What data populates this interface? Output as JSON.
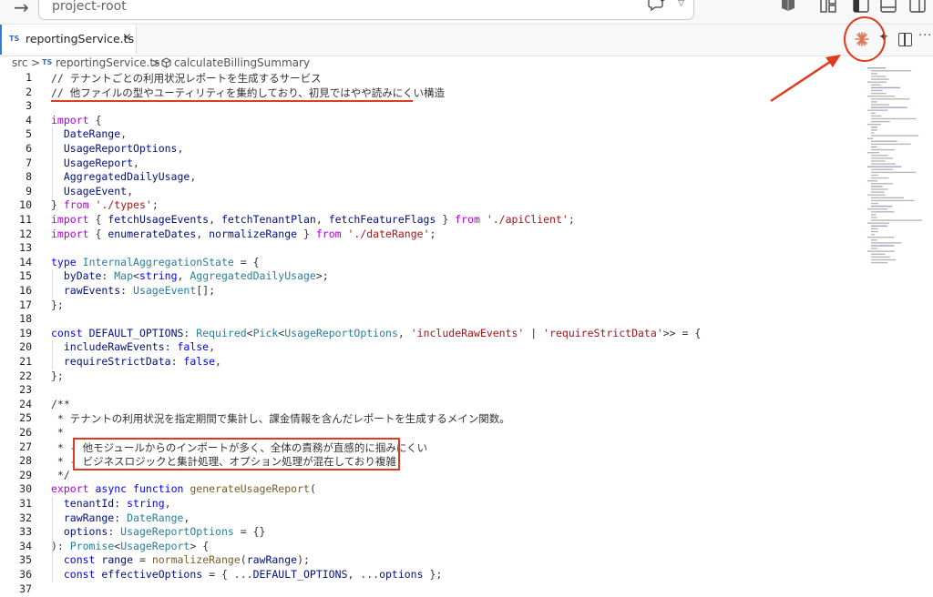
{
  "title_bar": {
    "back_label": "→",
    "command_center_text": "project-root"
  },
  "tab": {
    "badge": "TS",
    "label": "reportingService.ts",
    "close": "×"
  },
  "editor_actions": {
    "more": "···"
  },
  "breadcrumb": {
    "folder": "src",
    "sep": ">",
    "file_badge": "TS",
    "file": "reportingService.ts",
    "symbol": "calculateBillingSummary"
  },
  "code_lines": [
    {
      "n": "1",
      "segs": [
        [
          "cm",
          "// "
        ],
        [
          "cmj",
          "テナントごとの利用状況レポートを生成するサービス"
        ]
      ]
    },
    {
      "n": "2",
      "segs": [
        [
          "cm",
          "// "
        ],
        [
          "cmj",
          "他ファイルの型やユーティリティを集約しており、初見ではやや読みにくい構造"
        ]
      ]
    },
    {
      "n": "3",
      "segs": []
    },
    {
      "n": "4",
      "segs": [
        [
          "kw",
          "import"
        ],
        [
          "pl",
          " {"
        ]
      ]
    },
    {
      "n": "5",
      "segs": [
        [
          "va",
          "  DateRange"
        ],
        [
          "pl",
          ","
        ]
      ]
    },
    {
      "n": "6",
      "segs": [
        [
          "va",
          "  UsageReportOptions"
        ],
        [
          "pl",
          ","
        ]
      ]
    },
    {
      "n": "7",
      "segs": [
        [
          "va",
          "  UsageReport"
        ],
        [
          "pl",
          ","
        ]
      ]
    },
    {
      "n": "8",
      "segs": [
        [
          "va",
          "  AggregatedDailyUsage"
        ],
        [
          "pl",
          ","
        ]
      ]
    },
    {
      "n": "9",
      "segs": [
        [
          "va",
          "  UsageEvent"
        ],
        [
          "pl",
          ","
        ]
      ]
    },
    {
      "n": "10",
      "segs": [
        [
          "pl",
          "} "
        ],
        [
          "kw",
          "from"
        ],
        [
          "pl",
          " "
        ],
        [
          "st",
          "'./types'"
        ],
        [
          "pl",
          ";"
        ]
      ]
    },
    {
      "n": "11",
      "segs": [
        [
          "kw",
          "import"
        ],
        [
          "pl",
          " { "
        ],
        [
          "va",
          "fetchUsageEvents"
        ],
        [
          "pl",
          ", "
        ],
        [
          "va",
          "fetchTenantPlan"
        ],
        [
          "pl",
          ", "
        ],
        [
          "va",
          "fetchFeatureFlags"
        ],
        [
          "pl",
          " } "
        ],
        [
          "kw",
          "from"
        ],
        [
          "pl",
          " "
        ],
        [
          "st",
          "'./apiClient'"
        ],
        [
          "pl",
          ";"
        ]
      ]
    },
    {
      "n": "12",
      "segs": [
        [
          "kw",
          "import"
        ],
        [
          "pl",
          " { "
        ],
        [
          "va",
          "enumerateDates"
        ],
        [
          "pl",
          ", "
        ],
        [
          "va",
          "normalizeRange"
        ],
        [
          "pl",
          " } "
        ],
        [
          "kw",
          "from"
        ],
        [
          "pl",
          " "
        ],
        [
          "st",
          "'./dateRange'"
        ],
        [
          "pl",
          ";"
        ]
      ]
    },
    {
      "n": "13",
      "segs": []
    },
    {
      "n": "14",
      "segs": [
        [
          "kb",
          "type"
        ],
        [
          "pl",
          " "
        ],
        [
          "ty",
          "InternalAggregationState"
        ],
        [
          "pl",
          " = {"
        ]
      ]
    },
    {
      "n": "15",
      "segs": [
        [
          "va",
          "  byDate"
        ],
        [
          "pl",
          ": "
        ],
        [
          "ty",
          "Map"
        ],
        [
          "pl",
          "<"
        ],
        [
          "kb",
          "string"
        ],
        [
          "pl",
          ", "
        ],
        [
          "ty",
          "AggregatedDailyUsage"
        ],
        [
          "pl",
          ">;"
        ]
      ]
    },
    {
      "n": "16",
      "segs": [
        [
          "va",
          "  rawEvents"
        ],
        [
          "pl",
          ": "
        ],
        [
          "ty",
          "UsageEvent"
        ],
        [
          "pl",
          "[];"
        ]
      ]
    },
    {
      "n": "17",
      "segs": [
        [
          "pl",
          "};"
        ]
      ]
    },
    {
      "n": "18",
      "segs": []
    },
    {
      "n": "19",
      "segs": [
        [
          "kb",
          "const"
        ],
        [
          "pl",
          " "
        ],
        [
          "va",
          "DEFAULT_OPTIONS"
        ],
        [
          "pl",
          ": "
        ],
        [
          "ty",
          "Required"
        ],
        [
          "pl",
          "<"
        ],
        [
          "ty",
          "Pick"
        ],
        [
          "pl",
          "<"
        ],
        [
          "ty",
          "UsageReportOptions"
        ],
        [
          "pl",
          ", "
        ],
        [
          "st",
          "'includeRawEvents'"
        ],
        [
          "pl",
          " | "
        ],
        [
          "st",
          "'requireStrictData'"
        ],
        [
          "pl",
          ">> = {"
        ]
      ]
    },
    {
      "n": "20",
      "segs": [
        [
          "va",
          "  includeRawEvents"
        ],
        [
          "pl",
          ": "
        ],
        [
          "kb",
          "false"
        ],
        [
          "pl",
          ","
        ]
      ]
    },
    {
      "n": "21",
      "segs": [
        [
          "va",
          "  requireStrictData"
        ],
        [
          "pl",
          ": "
        ],
        [
          "kb",
          "false"
        ],
        [
          "pl",
          ","
        ]
      ]
    },
    {
      "n": "22",
      "segs": [
        [
          "pl",
          "};"
        ]
      ]
    },
    {
      "n": "23",
      "segs": []
    },
    {
      "n": "24",
      "segs": [
        [
          "cm",
          "/**"
        ]
      ]
    },
    {
      "n": "25",
      "segs": [
        [
          "cm",
          " * "
        ],
        [
          "cmj",
          "テナントの利用状況を指定期間で集計し、課金情報を含んだレポートを生成するメイン関数。"
        ]
      ]
    },
    {
      "n": "26",
      "segs": [
        [
          "cm",
          " *"
        ]
      ]
    },
    {
      "n": "27",
      "segs": [
        [
          "cm",
          " * - "
        ],
        [
          "cmj",
          "他モジュールからのインポートが多く、全体の責務が直感的に掴みにくい"
        ]
      ]
    },
    {
      "n": "28",
      "segs": [
        [
          "cm",
          " * - "
        ],
        [
          "cmj",
          "ビジネスロジックと集計処理、オプション処理が混在しており複雑"
        ]
      ]
    },
    {
      "n": "29",
      "segs": [
        [
          "cm",
          " */"
        ]
      ]
    },
    {
      "n": "30",
      "segs": [
        [
          "kw",
          "export"
        ],
        [
          "pl",
          " "
        ],
        [
          "kb",
          "async"
        ],
        [
          "pl",
          " "
        ],
        [
          "kb",
          "function"
        ],
        [
          "pl",
          " "
        ],
        [
          "fn",
          "generateUsageReport"
        ],
        [
          "pl",
          "("
        ]
      ]
    },
    {
      "n": "31",
      "segs": [
        [
          "va",
          "  tenantId"
        ],
        [
          "pl",
          ": "
        ],
        [
          "kb",
          "string"
        ],
        [
          "pl",
          ","
        ]
      ]
    },
    {
      "n": "32",
      "segs": [
        [
          "va",
          "  rawRange"
        ],
        [
          "pl",
          ": "
        ],
        [
          "ty",
          "DateRange"
        ],
        [
          "pl",
          ","
        ]
      ]
    },
    {
      "n": "33",
      "segs": [
        [
          "va",
          "  options"
        ],
        [
          "pl",
          ": "
        ],
        [
          "ty",
          "UsageReportOptions"
        ],
        [
          "pl",
          " = {}"
        ]
      ]
    },
    {
      "n": "34",
      "segs": [
        [
          "pl",
          "): "
        ],
        [
          "ty",
          "Promise"
        ],
        [
          "pl",
          "<"
        ],
        [
          "ty",
          "UsageReport"
        ],
        [
          "pl",
          "> {"
        ]
      ]
    },
    {
      "n": "35",
      "segs": [
        [
          "kb",
          "  const"
        ],
        [
          "pl",
          " "
        ],
        [
          "va",
          "range"
        ],
        [
          "pl",
          " = "
        ],
        [
          "fn",
          "normalizeRange"
        ],
        [
          "pl",
          "("
        ],
        [
          "va",
          "rawRange"
        ],
        [
          "pl",
          ");"
        ]
      ]
    },
    {
      "n": "36",
      "segs": [
        [
          "kb",
          "  const"
        ],
        [
          "pl",
          " "
        ],
        [
          "va",
          "effectiveOptions"
        ],
        [
          "pl",
          " = { ..."
        ],
        [
          "va",
          "DEFAULT_OPTIONS"
        ],
        [
          "pl",
          ", ..."
        ],
        [
          "va",
          "options"
        ],
        [
          "pl",
          " };"
        ]
      ]
    },
    {
      "n": "37",
      "segs": []
    }
  ],
  "colors": {
    "annotation_red": "#e13a1f",
    "claude_orange": "#d97757",
    "tab_accent": "#2f7dd8"
  },
  "icons": {
    "chat": "chat-sparkle-icon",
    "claude": "claude-spark-icon",
    "split": "split-editor-icon"
  }
}
